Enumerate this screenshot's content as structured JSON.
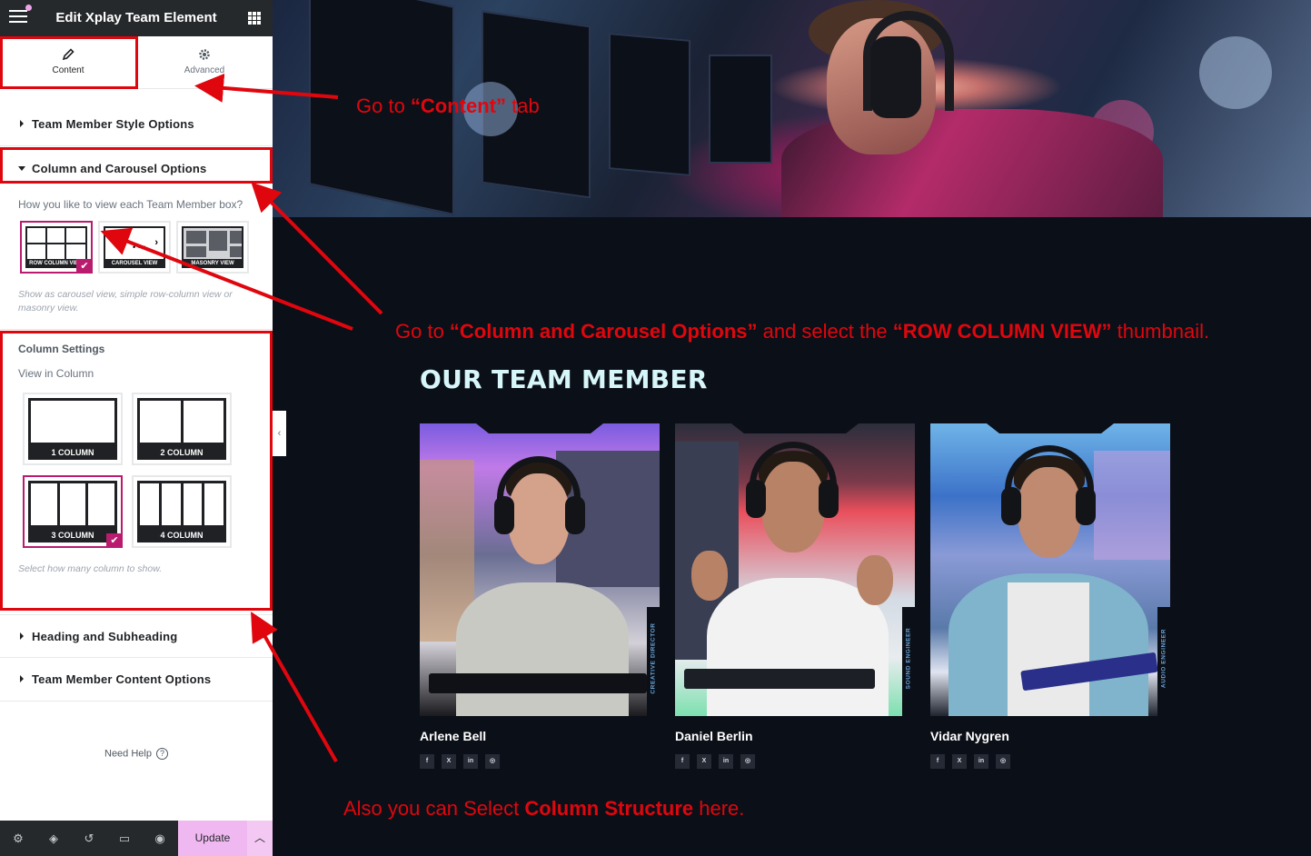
{
  "editor": {
    "title": "Edit Xplay Team Element",
    "tabs": [
      {
        "label": "Content",
        "icon": "pencil-icon",
        "active": true
      },
      {
        "label": "Advanced",
        "icon": "gear-icon",
        "active": false
      }
    ],
    "sections": [
      {
        "label": "Team Member Style Options",
        "open": false
      },
      {
        "label": "Column and Carousel Options",
        "open": true
      },
      {
        "label": "Heading and Subheading",
        "open": false
      },
      {
        "label": "Team Member Content Options",
        "open": false
      }
    ],
    "view_question": "How you like to view each Team Member box?",
    "view_options": [
      {
        "label": "ROW COLUMN VIEW",
        "selected": true
      },
      {
        "label": "CAROUSEL VIEW",
        "selected": false
      },
      {
        "label": "MASONRY VIEW",
        "selected": false
      }
    ],
    "view_note": "Show as carousel view, simple row-column view or masonry view.",
    "column_settings_title": "Column Settings",
    "view_in_column_label": "View in Column",
    "column_options": [
      {
        "label": "1 COLUMN",
        "selected": false
      },
      {
        "label": "2 COLUMN",
        "selected": false
      },
      {
        "label": "3 COLUMN",
        "selected": true
      },
      {
        "label": "4 COLUMN",
        "selected": false
      }
    ],
    "column_note": "Select how many column to show.",
    "need_help": "Need Help",
    "update_label": "Update",
    "bottom_icons": [
      "gear-icon",
      "layers-icon",
      "history-icon",
      "responsive-icon",
      "eye-icon"
    ]
  },
  "preview": {
    "heading": "OUR TEAM MEMBER",
    "members": [
      {
        "name": "Arlene Bell",
        "role": "CREATIVE DIRECTOR"
      },
      {
        "name": "Daniel Berlin",
        "role": "SOUND ENGINEER"
      },
      {
        "name": "Vidar Nygren",
        "role": "AUDIO ENGINEER"
      }
    ],
    "social_labels": [
      "f",
      "X",
      "in",
      "◎"
    ]
  },
  "annotations": {
    "a1_pre": "Go  to ",
    "a1_bold": "“Content”",
    "a1_post": " tab",
    "a2_pre": "Go to ",
    "a2_bold1": "“Column and Carousel Options”",
    "a2_mid": " and select the ",
    "a2_bold2": "“ROW COLUMN VIEW”",
    "a2_post": " thumbnail.",
    "a3_pre": "Also you can Select ",
    "a3_bold": "Column Structure",
    "a3_post": " here."
  },
  "colors": {
    "accent": "#b91c6e",
    "annotation_red": "#e0060e",
    "heading_cyan": "#d6f6fa",
    "update_pink": "#f0b8f0"
  }
}
